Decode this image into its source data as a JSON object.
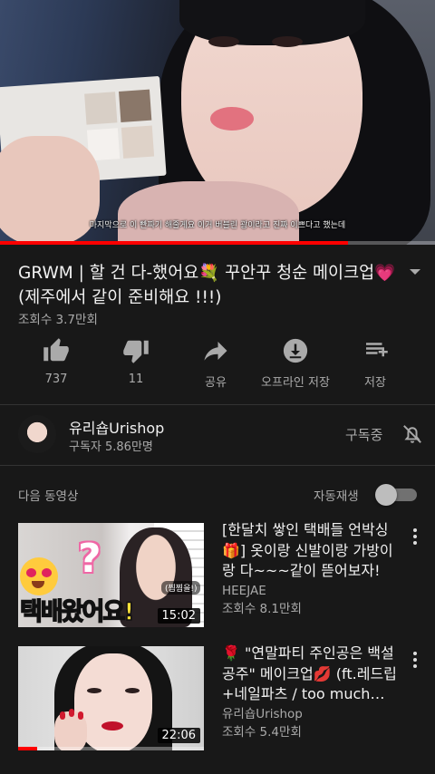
{
  "player": {
    "subtitle": "마지막으로 이 빤짜기 해줄게요 이거 버블린 광이라고 진짜 이쁘다고 했는데",
    "progress_fraction": 0.8
  },
  "video": {
    "title": "GRWM | 할 건 다-했어요💐 꾸안꾸 청순 메이크업💗 (제주에서 같이 준비해요 !!!)",
    "views": "조회수 3.7만회"
  },
  "actions": [
    {
      "icon": "thumb-up-icon",
      "label": "737"
    },
    {
      "icon": "thumb-down-icon",
      "label": "11"
    },
    {
      "icon": "share-icon",
      "label": "공유"
    },
    {
      "icon": "download-icon",
      "label": "오프라인 저장"
    },
    {
      "icon": "playlist-add-icon",
      "label": "저장"
    }
  ],
  "channel": {
    "name": "유리숍Urishop",
    "subscribers": "구독자 5.86만명",
    "subscribed_label": "구독중",
    "bell_icon": "bell-off-icon"
  },
  "up_next": {
    "label": "다음 동영상",
    "autoplay_label": "자동재생",
    "autoplay_on": false
  },
  "recommendations": [
    {
      "title": "[한달치 쌓인 택배들 언박싱🎁] 옷이랑 신발이랑 가방이랑 다~~~같이 뜯어보자!",
      "channel": "HEEJAE",
      "views": "조회수 8.1만회",
      "duration": "15:02",
      "thumb_caption_white": "택배",
      "thumb_caption_yellow": "왔어요!",
      "thumb_tag": "(찜찜을!)",
      "thumb_question": "?"
    },
    {
      "title": "🌹 \"연말파티 주인공은 백설공주\" 메이크업💋 (ft.레드립+네일파츠 / too much…",
      "channel": "유리숍Urishop",
      "views": "조회수 5.4만회",
      "duration": "22:06",
      "watched_fraction": 0.1
    }
  ],
  "colors": {
    "background": "#181818",
    "progress": "#ff0000",
    "text_secondary": "#aaaaaa"
  }
}
